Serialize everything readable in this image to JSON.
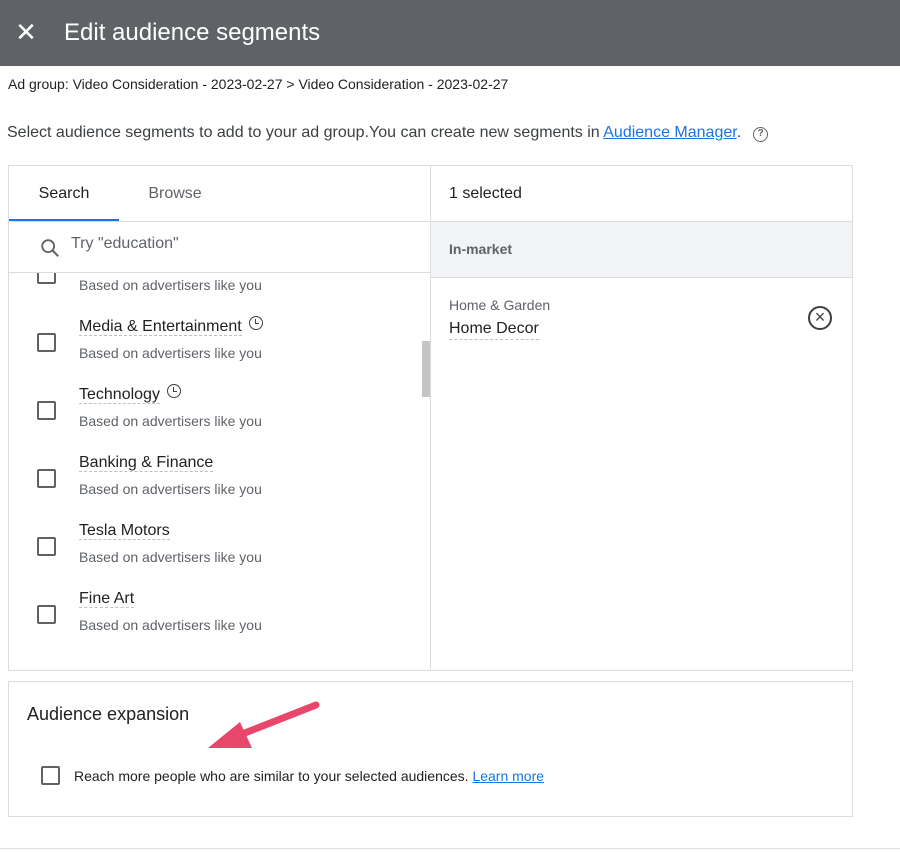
{
  "header": {
    "title": "Edit audience segments",
    "close_icon": "close-icon"
  },
  "breadcrumb": "Ad group: Video Consideration - 2023-02-27 > Video Consideration - 2023-02-27",
  "description": {
    "text": "Select audience segments to add to your ad group.You can create new segments in ",
    "link": "Audience Manager",
    "after": "."
  },
  "tabs": [
    {
      "label": "Search",
      "active": true
    },
    {
      "label": "Browse",
      "active": false
    }
  ],
  "search": {
    "placeholder": "Try \"education\""
  },
  "list": [
    {
      "name": "",
      "sub": "Based on advertisers like you",
      "clock": false
    },
    {
      "name": "Media & Entertainment",
      "sub": "Based on advertisers like you",
      "clock": true
    },
    {
      "name": "Technology",
      "sub": "Based on advertisers like you",
      "clock": true
    },
    {
      "name": "Banking & Finance",
      "sub": "Based on advertisers like you",
      "clock": false
    },
    {
      "name": "Tesla Motors",
      "sub": "Based on advertisers like you",
      "clock": false
    },
    {
      "name": "Fine Art",
      "sub": "Based on advertisers like you",
      "clock": false
    }
  ],
  "selected": {
    "count_label": "1 selected",
    "category": "In-market",
    "items": [
      {
        "parent": "Home & Garden",
        "name": "Home Decor"
      }
    ]
  },
  "expansion": {
    "title": "Audience expansion",
    "label": "Reach more people who are similar to your selected audiences. ",
    "link": "Learn more",
    "checked": false
  },
  "colors": {
    "header": "#5f6368",
    "accent": "#1a73e8",
    "arrow": "#e8466b"
  }
}
